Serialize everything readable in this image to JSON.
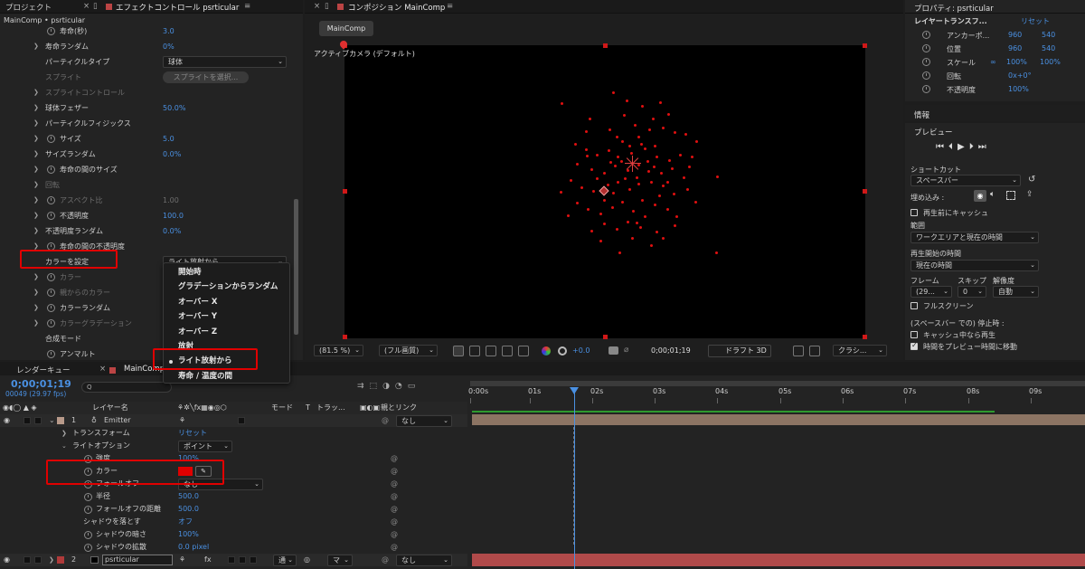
{
  "effect_panel": {
    "tab_project": "プロジェクト",
    "tab_effect": "エフェクトコントロール psrticular",
    "breadcrumb": "MainComp • psrticular",
    "rows": [
      {
        "label": "寿命(秒)",
        "value": "3.0"
      },
      {
        "label": "寿命ランダム",
        "value": "0%"
      },
      {
        "label": "パーティクルタイプ",
        "value": "球体"
      },
      {
        "label": "スプライト",
        "value": "スプライトを選択..."
      },
      {
        "label": "スプライトコントロール",
        "value": ""
      },
      {
        "label": "球体フェザー",
        "value": "50.0%"
      },
      {
        "label": "パーティクルフィジックス",
        "value": ""
      },
      {
        "label": "サイズ",
        "value": "5.0"
      },
      {
        "label": "サイズランダム",
        "value": "0.0%"
      },
      {
        "label": "寿命の間のサイズ",
        "value": ""
      },
      {
        "label": "回転",
        "value": ""
      },
      {
        "label": "アスペクト比",
        "value": "1.00"
      },
      {
        "label": "不透明度",
        "value": "100.0"
      },
      {
        "label": "不透明度ランダム",
        "value": "0.0%"
      },
      {
        "label": "寿命の間の不透明度",
        "value": ""
      },
      {
        "label": "カラーを設定",
        "value": "ライト放射から"
      },
      {
        "label": "カラー",
        "value": ""
      },
      {
        "label": "親からのカラー",
        "value": ""
      },
      {
        "label": "カラーランダム",
        "value": ""
      },
      {
        "label": "カラーグラデーション",
        "value": ""
      },
      {
        "label": "合成モード",
        "value": ""
      },
      {
        "label": "アンマルト",
        "value": ""
      }
    ],
    "menu": [
      "開始時",
      "グラデーションからランダム",
      "オーバー X",
      "オーバー Y",
      "オーバー Z",
      "放射",
      "ライト放射から",
      "寿命 / 温度の間"
    ]
  },
  "comp_panel": {
    "tab": "コンポジション MainComp",
    "comp_button": "MainComp",
    "camera_label": "アクティブカメラ (デフォルト)",
    "zoom": "(81.5 %)",
    "quality": "(フル画質)",
    "exposure": "+0.0",
    "timecode": "0;00;01;19",
    "draft": "ドラフト 3D",
    "renderer": "クラシ..."
  },
  "properties_panel": {
    "title": "プロパティ: psrticular",
    "section": "レイヤートランスフ...",
    "reset": "リセット",
    "anchor_label": "アンカーポ...",
    "anchor_x": "960",
    "anchor_y": "540",
    "position_label": "位置",
    "position_x": "960",
    "position_y": "540",
    "scale_label": "スケール",
    "scale_x": "100%",
    "scale_y": "100%",
    "rotation_label": "回転",
    "rotation": "0x+0°",
    "opacity_label": "不透明度",
    "opacity": "100%"
  },
  "info_panel": {
    "title": "情報"
  },
  "preview_panel": {
    "title": "プレビュー",
    "shortcut_label": "ショートカット",
    "shortcut_value": "スペースバー",
    "embed_label": "埋め込み :",
    "cache_label": "再生前にキャッシュ",
    "range_label": "範囲",
    "range_value": "ワークエリアと現在の時間",
    "start_label": "再生開始の時間",
    "start_value": "現在の時間",
    "frame_label": "フレーム",
    "skip_label": "スキップ",
    "res_label": "解像度",
    "frame_value": "(29...",
    "skip_value": "0",
    "res_value": "自動",
    "fullscreen_label": "フルスクリーン",
    "stop_label": "(スペースバー での) 停止時 :",
    "stop_cache_label": "キャッシュ中なら再生",
    "stop_move_label": "時間をプレビュー時間に移動"
  },
  "timeline": {
    "tab_render": "レンダーキュー",
    "tab_comp": "MainComp",
    "timecode": "0;00;01;19",
    "frames": "00049 (29.97 fps)",
    "search_placeholder": "Q",
    "col_layer": "レイヤー名",
    "col_mode": "モード",
    "col_t": "T",
    "col_track": "トラッ...",
    "col_parent": "親とリンク",
    "ruler": [
      "0:00s",
      "01s",
      "02s",
      "03s",
      "04s",
      "05s",
      "06s",
      "07s",
      "08s",
      "09s"
    ],
    "layers": [
      {
        "num": "1",
        "name": "Emitter",
        "parent": "なし"
      },
      {
        "num": "2",
        "name": "psrticular",
        "parent": "なし",
        "mode": "通",
        "track": "マ"
      }
    ],
    "props": [
      {
        "label": "トランスフォーム",
        "value": "リセット"
      },
      {
        "label": "ライトオプション",
        "value": "ポイント"
      },
      {
        "label": "強度",
        "value": "100%"
      },
      {
        "label": "カラー",
        "value": ""
      },
      {
        "label": "フォールオフ",
        "value": "なし"
      },
      {
        "label": "半径",
        "value": "500.0"
      },
      {
        "label": "フォールオフの距離",
        "value": "500.0"
      },
      {
        "label": "シャドウを落とす",
        "value": "オフ"
      },
      {
        "label": "シャドウの暗さ",
        "value": "100%"
      },
      {
        "label": "シャドウの拡散",
        "value": "0.0 pixel"
      }
    ]
  },
  "colors": {
    "accent": "#4a90e2",
    "highlight": "#e00000",
    "particle": "#e01010",
    "layer_bar": "#8c7463"
  }
}
